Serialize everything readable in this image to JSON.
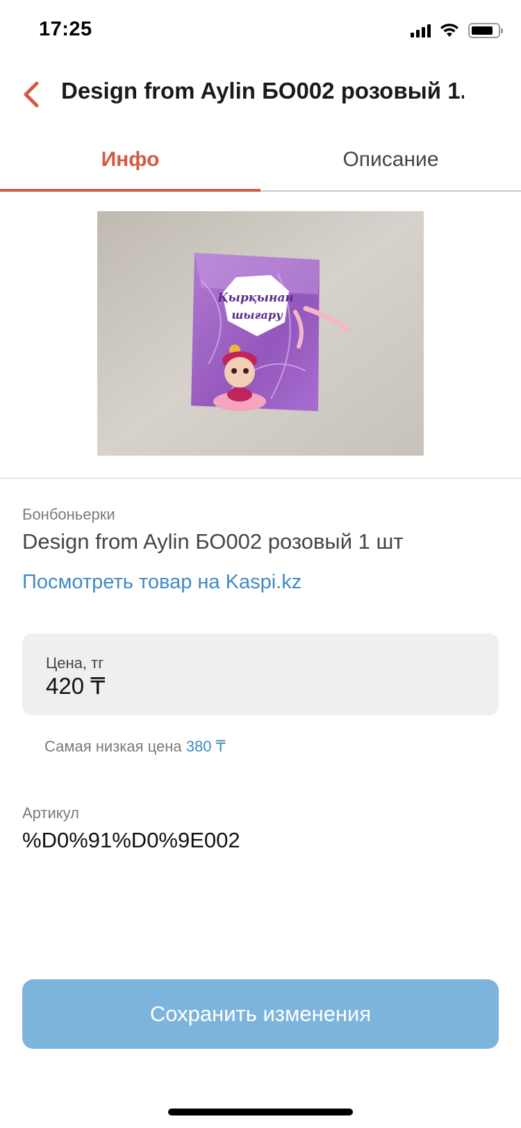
{
  "status_bar": {
    "time": "17:25",
    "icons": [
      "signal-icon",
      "wifi-icon",
      "battery-icon"
    ]
  },
  "nav": {
    "back_icon": "chevron-left-icon",
    "title": "Design from Aylin БО002 розовый 1..."
  },
  "tabs": [
    {
      "label": "Инфо",
      "active": true
    },
    {
      "label": "Описание",
      "active": false
    }
  ],
  "product": {
    "image_text": [
      "Қырқынан",
      "шығару"
    ],
    "category": "Бонбоньерки",
    "name": "Design from Aylin БО002 розовый 1 шт",
    "kaspi_link": "Посмотреть товар на Kaspi.kz"
  },
  "price": {
    "label": "Цена, тг",
    "value": "420 ₸"
  },
  "lowest_price": {
    "label": "Самая низкая цена",
    "value": "380 ₸"
  },
  "sku": {
    "label": "Артикул",
    "value": "%D0%91%D0%9E002"
  },
  "save_button": {
    "label": "Сохранить изменения"
  },
  "colors": {
    "accent": "#d55a44",
    "link": "#3f8bc2",
    "button": "#7db4dc",
    "field_bg": "#efefef"
  }
}
